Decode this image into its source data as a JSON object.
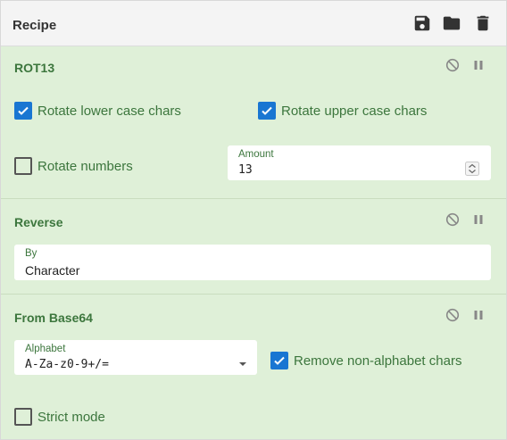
{
  "header": {
    "title": "Recipe",
    "icons": [
      "save-icon",
      "folder-icon",
      "trash-icon"
    ]
  },
  "operations": [
    {
      "name": "ROT13",
      "options": {
        "rotate_lower": {
          "label": "Rotate lower case chars",
          "checked": true
        },
        "rotate_upper": {
          "label": "Rotate upper case chars",
          "checked": true
        },
        "rotate_numbers": {
          "label": "Rotate numbers",
          "checked": false
        },
        "amount": {
          "label": "Amount",
          "value": "13"
        }
      }
    },
    {
      "name": "Reverse",
      "options": {
        "by": {
          "label": "By",
          "value": "Character"
        }
      }
    },
    {
      "name": "From Base64",
      "options": {
        "alphabet": {
          "label": "Alphabet",
          "value": "A-Za-z0-9+/="
        },
        "remove_non_alphabet": {
          "label": "Remove non-alphabet chars",
          "checked": true
        },
        "strict_mode": {
          "label": "Strict mode",
          "checked": false
        }
      }
    }
  ],
  "colors": {
    "op_background": "#dff0d8",
    "op_text": "#3c763d",
    "checkbox_checked": "#1976d2"
  }
}
